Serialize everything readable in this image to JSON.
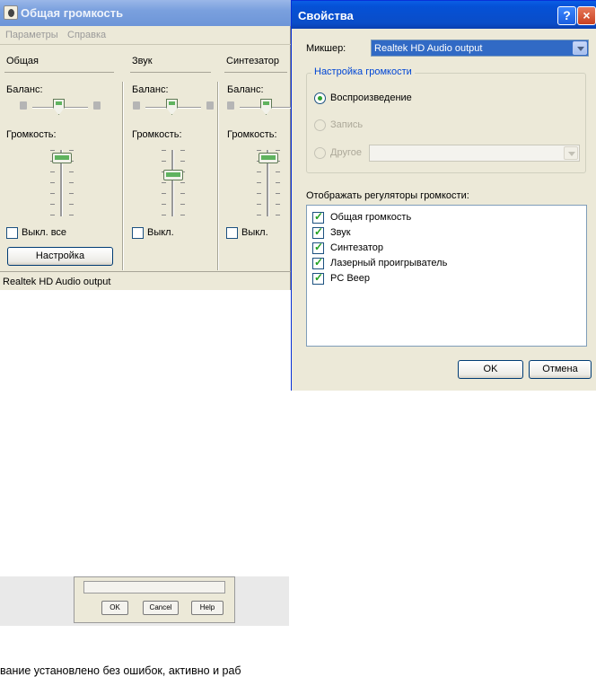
{
  "volume_window": {
    "title": "Общая громкость",
    "menu": [
      "Параметры",
      "Справка"
    ],
    "columns": [
      {
        "title": "Общая",
        "balance_label": "Баланс:",
        "volume_label": "Громкость:",
        "volume_level": 0.95,
        "mute_label": "Выкл. все"
      },
      {
        "title": "Звук",
        "balance_label": "Баланс:",
        "volume_label": "Громкость:",
        "volume_level": 0.65,
        "mute_label": "Выкл."
      },
      {
        "title": "Синтезатор",
        "balance_label": "Баланс:",
        "volume_label": "Громкость:",
        "volume_level": 0.95,
        "mute_label": "Выкл."
      }
    ],
    "settings_button": "Настройка",
    "status": "Realtek HD Audio output"
  },
  "background": {
    "buttons": [
      "OK",
      "Cancel",
      "Help"
    ],
    "text": "вание установлено без ошибок, активно и раб"
  },
  "properties_dialog": {
    "title": "Свойства",
    "help_icon": "?",
    "close_icon": "×",
    "mixer_label": "Микшер:",
    "mixer_value": "Realtek HD Audio output",
    "group_title": "Настройка громкости",
    "radios": [
      {
        "label": "Воспроизведение",
        "selected": true,
        "enabled": true
      },
      {
        "label": "Запись",
        "selected": false,
        "enabled": false
      },
      {
        "label": "Другое",
        "selected": false,
        "enabled": false
      }
    ],
    "list_label": "Отображать регуляторы громкости:",
    "controls": [
      {
        "label": "Общая громкость",
        "checked": true
      },
      {
        "label": "Звук",
        "checked": true
      },
      {
        "label": "Синтезатор",
        "checked": true
      },
      {
        "label": "Лазерный проигрыватель",
        "checked": true
      },
      {
        "label": "PC Beep",
        "checked": true
      }
    ],
    "ok_label": "OK",
    "cancel_label": "Отмена"
  },
  "colors": {
    "title_active": "#0a54d8",
    "title_inactive": "#7aa0de",
    "face": "#ece9d8",
    "accent_green": "#21a121"
  }
}
